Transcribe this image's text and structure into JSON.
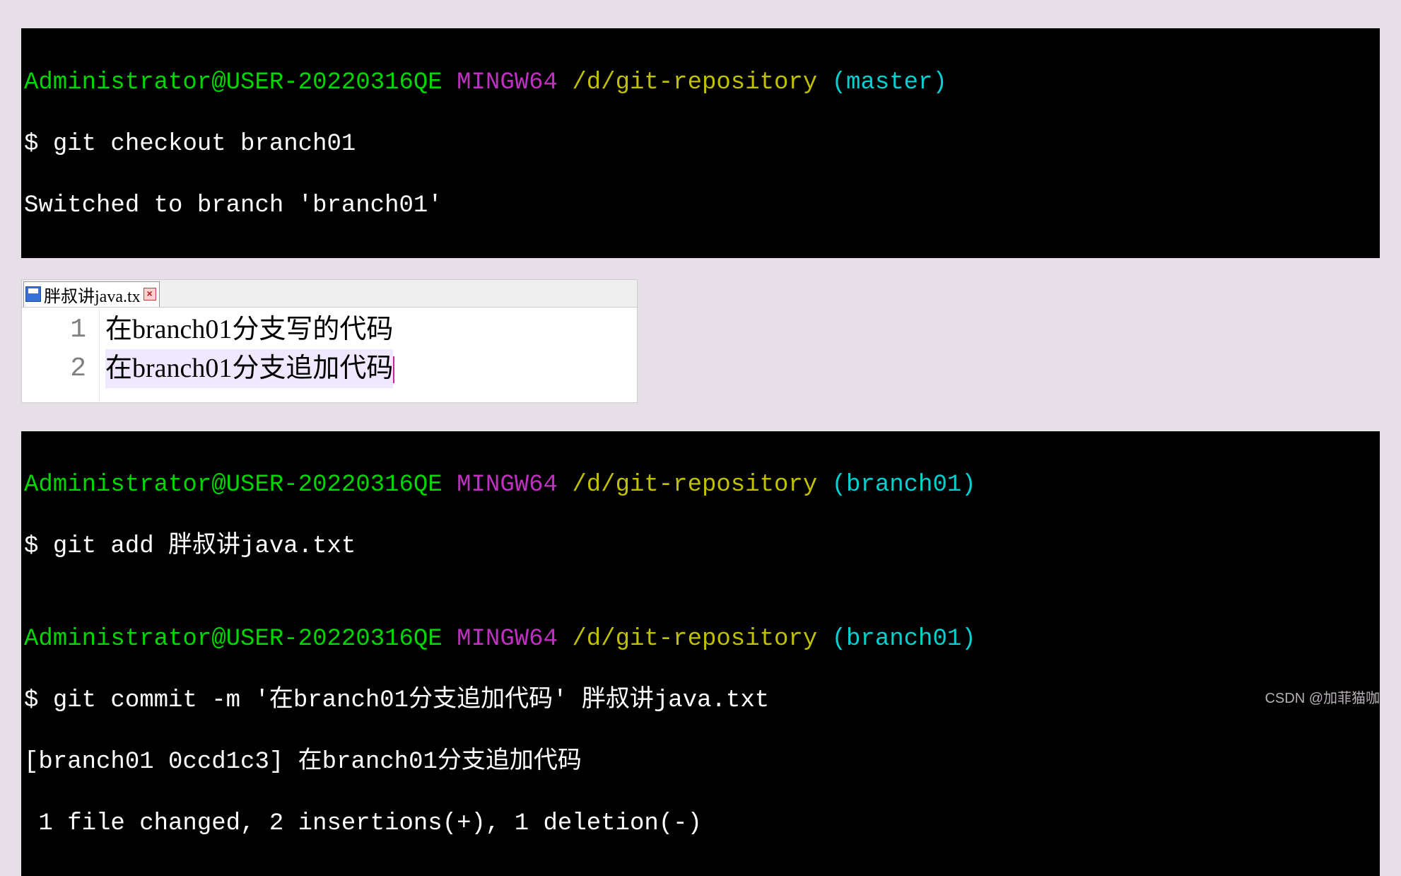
{
  "terminal1": {
    "user": "Administrator",
    "at": "@",
    "host": "USER-20220316QE",
    "shell": "MINGW64",
    "path": "/d/git-repository",
    "branch_open": "(",
    "branch": "master",
    "branch_close": ")",
    "prompt": "$ ",
    "command": "git checkout branch01",
    "output": "Switched to branch 'branch01'"
  },
  "editor": {
    "tab": {
      "filename": "胖叔讲java.tx",
      "close_glyph": "×"
    },
    "gutter": [
      "1",
      "2"
    ],
    "lines": {
      "l1": "在branch01分支写的代码",
      "l2": "在branch01分支追加代码"
    }
  },
  "terminal2": {
    "p1": {
      "user": "Administrator",
      "at": "@",
      "host": "USER-20220316QE",
      "shell": "MINGW64",
      "path": "/d/git-repository",
      "branch_open": "(",
      "branch": "branch01",
      "branch_close": ")",
      "prompt": "$ ",
      "command": "git add 胖叔讲java.txt"
    },
    "blank": "",
    "p2": {
      "user": "Administrator",
      "at": "@",
      "host": "USER-20220316QE",
      "shell": "MINGW64",
      "path": "/d/git-repository",
      "branch_open": "(",
      "branch": "branch01",
      "branch_close": ")",
      "prompt": "$ ",
      "command": "git commit -m '在branch01分支追加代码' 胖叔讲java.txt",
      "out1": "[branch01 0ccd1c3] 在branch01分支追加代码",
      "out2": " 1 file changed, 2 insertions(+), 1 deletion(-)"
    }
  },
  "watermark": "CSDN @加菲猫咖"
}
